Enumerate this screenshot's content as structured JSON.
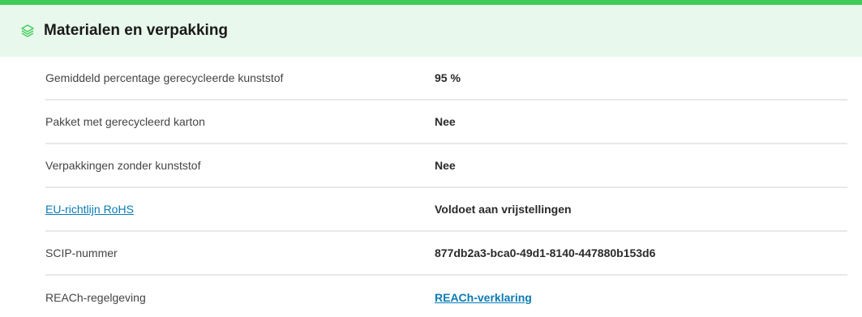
{
  "section": {
    "title": "Materialen en verpakking",
    "icon": "layers-icon",
    "accent_color": "#3dcd58",
    "header_bg": "#e9f8ec"
  },
  "rows": [
    {
      "label": "Gemiddeld percentage gerecycleerde kunststof",
      "value": "95 %"
    },
    {
      "label": "Pakket met gerecycleerd karton",
      "value": "Nee"
    },
    {
      "label": "Verpakkingen zonder kunststof",
      "value": "Nee"
    },
    {
      "label": "EU-richtlijn RoHS",
      "value": "Voldoet aan vrijstellingen",
      "label_is_link": true
    },
    {
      "label": "SCIP-nummer",
      "value": "877db2a3-bca0-49d1-8140-447880b153d6"
    },
    {
      "label": "REACh-regelgeving",
      "value": "REACh-verklaring",
      "value_is_link": true
    }
  ],
  "link_color": "#0a7bb5"
}
